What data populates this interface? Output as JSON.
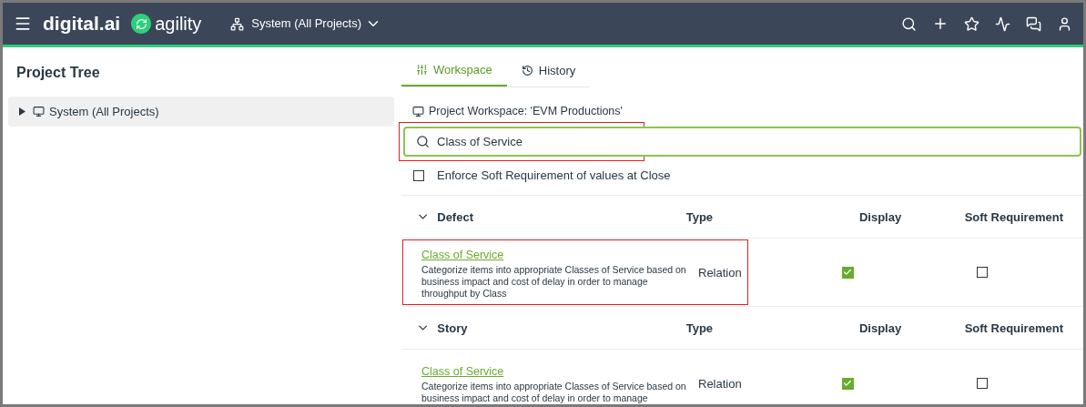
{
  "header": {
    "brand": "digital.ai",
    "product": "agility",
    "scope": "System (All Projects)"
  },
  "project_tree": {
    "title": "Project Tree",
    "items": [
      {
        "label": "System (All Projects)",
        "expanded": false
      }
    ]
  },
  "tabs": [
    {
      "label": "Workspace",
      "selected": true
    },
    {
      "label": "History",
      "selected": false
    }
  ],
  "workspace_label": "Project Workspace: 'EVM Productions'",
  "search": {
    "value": "Class of Service",
    "highlighted": true
  },
  "enforce": {
    "label": "Enforce Soft Requirement of values at Close",
    "checked": false
  },
  "groups": [
    {
      "name": "Defect",
      "expanded": true,
      "columns": [
        "Type",
        "Display",
        "Soft Requirement"
      ],
      "rows": [
        {
          "title": "Class of Service",
          "description": "Categorize items into appropriate Classes of Service based on business impact and cost of delay in order to manage throughput by Class",
          "type": "Relation",
          "display": true,
          "soft_requirement": false,
          "highlighted": true
        }
      ]
    },
    {
      "name": "Story",
      "expanded": true,
      "columns": [
        "Type",
        "Display",
        "Soft Requirement"
      ],
      "rows": [
        {
          "title": "Class of Service",
          "description": "Categorize items into appropriate Classes of Service based on business impact and cost of delay in order to manage",
          "type": "Relation",
          "display": true,
          "soft_requirement": false,
          "highlighted": false
        }
      ]
    }
  ]
}
